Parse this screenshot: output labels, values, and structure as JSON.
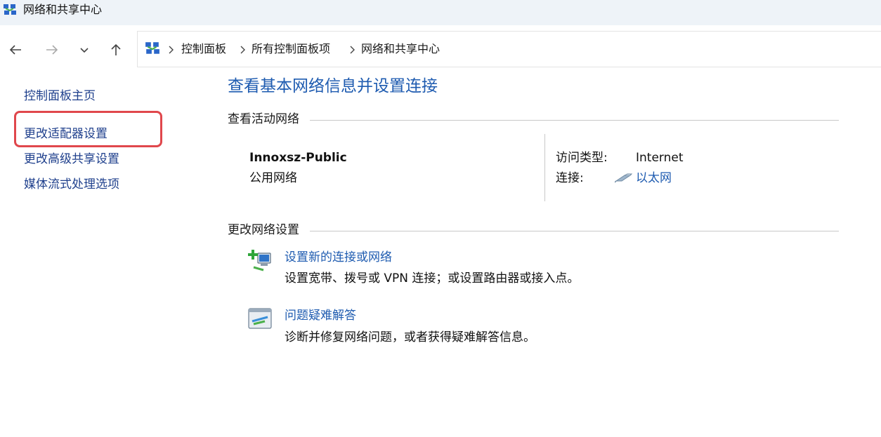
{
  "window": {
    "title": "网络和共享中心",
    "icon": "network-center-icon"
  },
  "nav": {
    "back_icon": "arrow-left-icon",
    "forward_icon": "arrow-right-icon",
    "recent_icon": "chevron-down-icon",
    "up_icon": "arrow-up-icon"
  },
  "breadcrumb": {
    "icon": "network-center-icon",
    "items": [
      "控制面板",
      "所有控制面板项",
      "网络和共享中心"
    ]
  },
  "sidebar": {
    "items": [
      {
        "label": "控制面板主页"
      },
      {
        "label": "更改适配器设置",
        "highlighted": true
      },
      {
        "label": "更改高级共享设置"
      },
      {
        "label": "媒体流式处理选项"
      }
    ],
    "highlight_color": "#e0474c"
  },
  "main": {
    "title": "查看基本网络信息并设置连接",
    "active_networks_heading": "查看活动网络",
    "network": {
      "name": "Innoxsz-Public",
      "type": "公用网络",
      "access_type_label": "访问类型:",
      "access_type_value": "Internet",
      "connection_label": "连接:",
      "connection_value": "以太网",
      "connection_icon": "ethernet-icon"
    },
    "change_settings_heading": "更改网络设置",
    "tasks": [
      {
        "icon": "new-connection-icon",
        "link": "设置新的连接或网络",
        "description": "设置宽带、拨号或 VPN 连接；或设置路由器或接入点。"
      },
      {
        "icon": "troubleshoot-icon",
        "link": "问题疑难解答",
        "description": "诊断并修复网络问题，或者获得疑难解答信息。"
      }
    ]
  },
  "colors": {
    "link": "#1e5bb0",
    "sidebar_link": "#1e3f8c",
    "titlebar_bg": "#eef3f8"
  }
}
